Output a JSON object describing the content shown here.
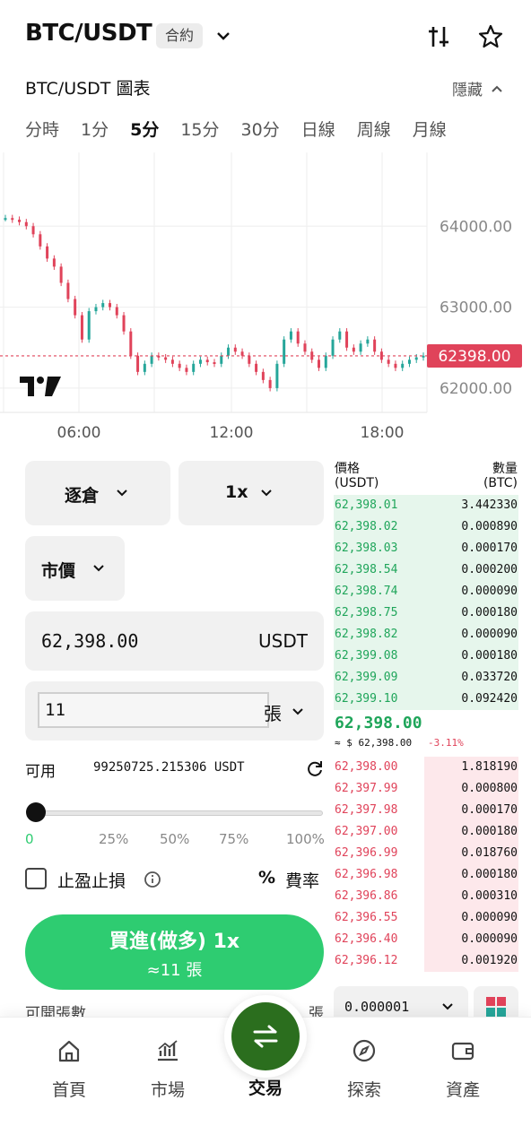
{
  "header": {
    "pair": "BTC/USDT",
    "badge": "合約"
  },
  "subheader": {
    "title": "BTC/USDT 圖表",
    "hide_label": "隱藏"
  },
  "tabs": [
    "分時",
    "1分",
    "5分",
    "15分",
    "30分",
    "日線",
    "周線",
    "月線"
  ],
  "active_tab": "5分",
  "chart_data": {
    "type": "line",
    "price_ticks": [
      "64000.00",
      "63000.00",
      "62000.00"
    ],
    "time_ticks": [
      "06:00",
      "12:00",
      "18:00"
    ],
    "current_price": "62398.00",
    "ylim": [
      61700,
      64800
    ],
    "series": [
      {
        "values": [
          64100,
          64080,
          64050,
          64000,
          63900,
          63750,
          63600,
          63500,
          63300,
          63100,
          62900,
          62600,
          62950,
          63000,
          63050,
          63000,
          62900,
          62700,
          62400,
          62200,
          62300,
          62400,
          62380,
          62350,
          62300,
          62250,
          62200,
          62300,
          62350,
          62320,
          62300,
          62400,
          62500,
          62450,
          62400,
          62300,
          62200,
          62100,
          62000,
          62300,
          62600,
          62700,
          62550,
          62450,
          62350,
          62250,
          62400,
          62600,
          62700,
          62500,
          62450,
          62550,
          62600,
          62450,
          62350,
          62300,
          62250,
          62300,
          62350,
          62380,
          62400
        ]
      }
    ],
    "colors": {
      "up": "#26a69a",
      "down": "#e0435a",
      "line": "#26a69a",
      "current": "#e0435a"
    }
  },
  "controls": {
    "margin_mode": "逐倉",
    "leverage": "1x",
    "order_type": "市價",
    "price": "62,398.00",
    "price_unit": "USDT",
    "quantity": "11",
    "quantity_unit": "張",
    "available_label": "可用",
    "available_value": "99250725.215306 USDT",
    "slider_ticks": [
      "0",
      "25%",
      "50%",
      "75%",
      "100%"
    ],
    "slider_level": 0,
    "tpsl_label": "止盈止損",
    "fee_symbol": "%",
    "fee_label": "費率",
    "buy_line1": "買進(做多) 1x",
    "buy_line2": "≈11 張",
    "peek_label": "可開張數",
    "peek_unit": "張"
  },
  "orderbook": {
    "header": {
      "price": "價格",
      "price_unit": "(USDT)",
      "qty": "數量",
      "qty_unit": "(BTC)"
    },
    "asks": [
      {
        "p": "62,398.01",
        "q": "3.442330"
      },
      {
        "p": "62,398.02",
        "q": "0.000890"
      },
      {
        "p": "62,398.03",
        "q": "0.000170"
      },
      {
        "p": "62,398.54",
        "q": "0.000200"
      },
      {
        "p": "62,398.74",
        "q": "0.000090"
      },
      {
        "p": "62,398.75",
        "q": "0.000180"
      },
      {
        "p": "62,398.82",
        "q": "0.000090"
      },
      {
        "p": "62,399.08",
        "q": "0.000180"
      },
      {
        "p": "62,399.09",
        "q": "0.033720"
      },
      {
        "p": "62,399.10",
        "q": "0.092420"
      }
    ],
    "last_price": "62,398.00",
    "last_usd": "≈ $ 62,398.00",
    "change": "-3.11%",
    "bids": [
      {
        "p": "62,398.00",
        "q": "1.818190"
      },
      {
        "p": "62,397.99",
        "q": "0.000800"
      },
      {
        "p": "62,397.98",
        "q": "0.000170"
      },
      {
        "p": "62,397.00",
        "q": "0.000180"
      },
      {
        "p": "62,396.99",
        "q": "0.018760"
      },
      {
        "p": "62,396.98",
        "q": "0.000180"
      },
      {
        "p": "62,396.86",
        "q": "0.000310"
      },
      {
        "p": "62,396.55",
        "q": "0.000090"
      },
      {
        "p": "62,396.40",
        "q": "0.000090"
      },
      {
        "p": "62,396.12",
        "q": "0.001920"
      }
    ],
    "step": "0.000001"
  },
  "nav": [
    {
      "label": "首頁",
      "icon": "home-icon"
    },
    {
      "label": "市場",
      "icon": "market-chart-icon"
    },
    {
      "label": "交易",
      "icon": "swap-icon"
    },
    {
      "label": "探索",
      "icon": "compass-icon"
    },
    {
      "label": "資產",
      "icon": "wallet-icon"
    }
  ]
}
